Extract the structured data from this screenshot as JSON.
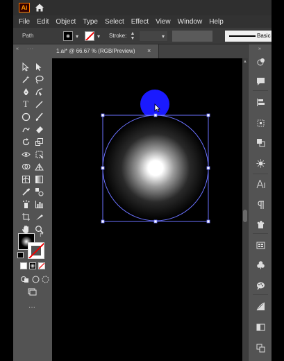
{
  "app": {
    "logo_text": "Ai",
    "menu": [
      "File",
      "Edit",
      "Object",
      "Type",
      "Select",
      "Effect",
      "View",
      "Window",
      "Help"
    ]
  },
  "control_bar": {
    "selection_type": "Path",
    "stroke_label": "Stroke:",
    "brush_label": "Basic"
  },
  "document": {
    "tab_label": "1.ai* @ 66.67 % (RGB/Preview)",
    "close_glyph": "×"
  },
  "toolbar": {
    "type_tool_glyph": "T",
    "more_tools_glyph": "···"
  },
  "colors": {
    "interface_bg": "#535353",
    "canvas_bg": "#000000",
    "selection_outline": "#6b72ff",
    "blue_circle": "#1a1aff",
    "gradient_center": "#ffffff",
    "gradient_edge": "#000000"
  },
  "icons": {
    "right_panel": [
      "properties-icon",
      "comments-icon",
      "align-icon",
      "transform-icon",
      "pathfinder-icon",
      "appearance-icon",
      "character-icon",
      "paragraph-icon",
      "symbols-icon",
      "libraries-icon",
      "swatches-icon",
      "brushes-icon",
      "gradient-icon",
      "transparency-icon",
      "artboards-icon"
    ]
  }
}
